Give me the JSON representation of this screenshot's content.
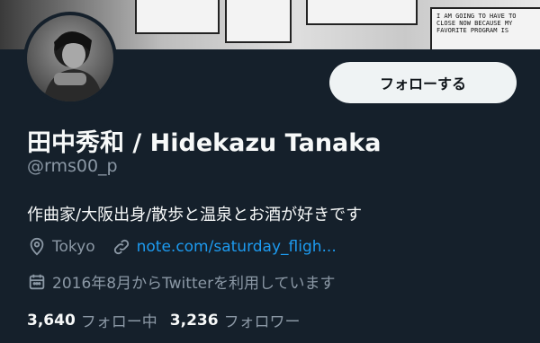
{
  "banner": {
    "comic_text": "I AM GOING TO HAVE TO CLOSE NOW BECAUSE MY FAVORITE PROGRAM IS"
  },
  "profile": {
    "display_name": "田中秀和 / Hidekazu Tanaka",
    "handle": "@rms00_p",
    "bio": "作曲家/大阪出身/散歩と温泉とお酒が好きです",
    "location": "Tokyo",
    "website": "note.com/saturday_fligh...",
    "joined": "2016年8月からTwitterを利用しています"
  },
  "actions": {
    "follow_label": "フォローする"
  },
  "stats": {
    "following_count": "3,640",
    "following_label": "フォロー中",
    "followers_count": "3,236",
    "followers_label": "フォロワー"
  },
  "icons": {
    "location": "location-pin-icon",
    "link": "link-icon",
    "calendar": "calendar-icon"
  },
  "colors": {
    "background": "#15202b",
    "text_primary": "#f7f9f9",
    "text_secondary": "#8b98a5",
    "link": "#1d9bf0",
    "button_bg": "#eff3f4"
  }
}
